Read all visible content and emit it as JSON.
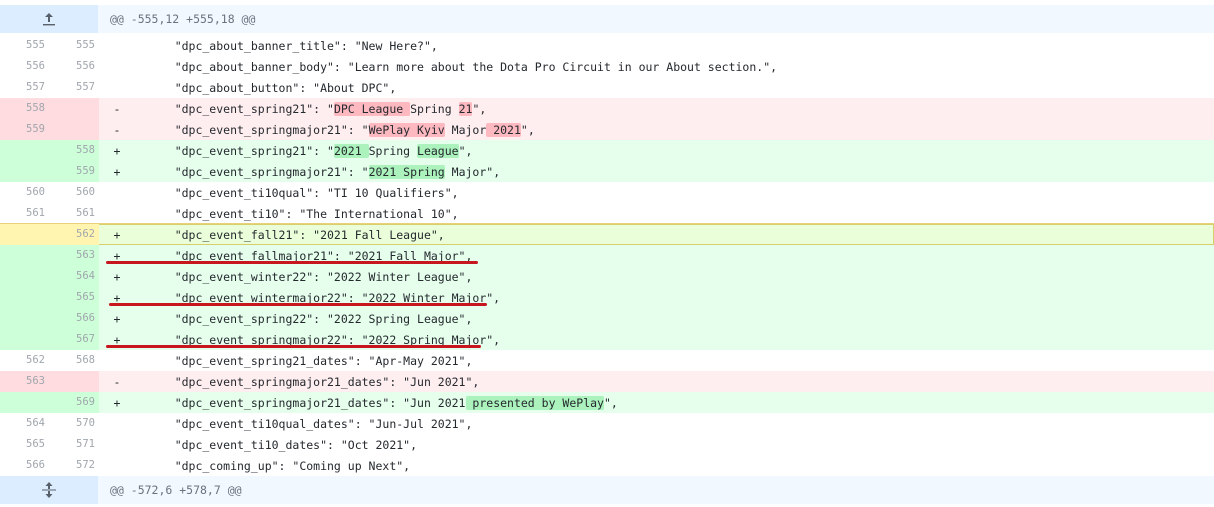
{
  "hunk_top": {
    "header": "@@ -555,12 +555,18 @@",
    "icon": "expand-up-icon"
  },
  "hunk_bottom": {
    "header": "@@ -572,6 +578,7 @@",
    "icon": "expand-both-icon"
  },
  "lines": [
    {
      "type": "ctx",
      "old": "555",
      "new": "555",
      "marker": "",
      "segments": [
        {
          "t": "    \"dpc_about_banner_title\": \"New Here?\","
        }
      ]
    },
    {
      "type": "ctx",
      "old": "556",
      "new": "556",
      "marker": "",
      "segments": [
        {
          "t": "    \"dpc_about_banner_body\": \"Learn more about the Dota Pro Circuit in our About section.\","
        }
      ]
    },
    {
      "type": "ctx",
      "old": "557",
      "new": "557",
      "marker": "",
      "segments": [
        {
          "t": "    \"dpc_about_button\": \"About DPC\","
        }
      ]
    },
    {
      "type": "del",
      "old": "558",
      "new": "",
      "marker": "-",
      "segments": [
        {
          "t": "    \"dpc_event_spring21\": \""
        },
        {
          "t": "DPC League ",
          "w": 1
        },
        {
          "t": "Spring "
        },
        {
          "t": "21",
          "w": 1
        },
        {
          "t": "\","
        }
      ]
    },
    {
      "type": "del",
      "old": "559",
      "new": "",
      "marker": "-",
      "segments": [
        {
          "t": "    \"dpc_event_springmajor21\": \""
        },
        {
          "t": "WePlay Kyiv",
          "w": 1
        },
        {
          "t": " Major"
        },
        {
          "t": " 2021",
          "w": 1
        },
        {
          "t": "\","
        }
      ]
    },
    {
      "type": "add",
      "old": "",
      "new": "558",
      "marker": "+",
      "segments": [
        {
          "t": "    \"dpc_event_spring21\": \""
        },
        {
          "t": "2021 ",
          "w": 1
        },
        {
          "t": "Spring "
        },
        {
          "t": "League",
          "w": 1
        },
        {
          "t": "\","
        }
      ]
    },
    {
      "type": "add",
      "old": "",
      "new": "559",
      "marker": "+",
      "segments": [
        {
          "t": "    \"dpc_event_springmajor21\": \""
        },
        {
          "t": "2021 Spring",
          "w": 1
        },
        {
          "t": " Major\","
        }
      ]
    },
    {
      "type": "ctx",
      "old": "560",
      "new": "560",
      "marker": "",
      "segments": [
        {
          "t": "    \"dpc_event_ti10qual\": \"TI 10 Qualifiers\","
        }
      ]
    },
    {
      "type": "ctx",
      "old": "561",
      "new": "561",
      "marker": "",
      "segments": [
        {
          "t": "    \"dpc_event_ti10\": \"The International 10\","
        }
      ]
    },
    {
      "type": "hl",
      "old": "",
      "new": "562",
      "marker": "+",
      "segments": [
        {
          "t": "    \"dpc_event_fall21\": \"2021 Fall League\","
        }
      ]
    },
    {
      "type": "add",
      "old": "",
      "new": "563",
      "marker": "+",
      "segments": [
        {
          "t": "    \"dpc_event_fallmajor21\": \"2021 Fall Major\","
        }
      ]
    },
    {
      "type": "add",
      "old": "",
      "new": "564",
      "marker": "+",
      "segments": [
        {
          "t": "    \"dpc_event_winter22\": \"2022 Winter League\","
        }
      ]
    },
    {
      "type": "add",
      "old": "",
      "new": "565",
      "marker": "+",
      "segments": [
        {
          "t": "    \"dpc_event_wintermajor22\": \"2022 Winter Major\","
        }
      ]
    },
    {
      "type": "add",
      "old": "",
      "new": "566",
      "marker": "+",
      "segments": [
        {
          "t": "    \"dpc_event_spring22\": \"2022 Spring League\","
        }
      ]
    },
    {
      "type": "add",
      "old": "",
      "new": "567",
      "marker": "+",
      "segments": [
        {
          "t": "    \"dpc_event_springmajor22\": \"2022 Spring Major\","
        }
      ]
    },
    {
      "type": "ctx",
      "old": "562",
      "new": "568",
      "marker": "",
      "segments": [
        {
          "t": "    \"dpc_event_spring21_dates\": \"Apr-May 2021\","
        }
      ]
    },
    {
      "type": "del",
      "old": "563",
      "new": "",
      "marker": "-",
      "segments": [
        {
          "t": "    \"dpc_event_springmajor21_dates\": \"Jun 2021\","
        }
      ]
    },
    {
      "type": "add",
      "old": "",
      "new": "569",
      "marker": "+",
      "segments": [
        {
          "t": "    \"dpc_event_springmajor21_dates\": \"Jun 2021"
        },
        {
          "t": " presented by WePlay",
          "w": 1
        },
        {
          "t": "\","
        }
      ]
    },
    {
      "type": "ctx",
      "old": "564",
      "new": "570",
      "marker": "",
      "segments": [
        {
          "t": "    \"dpc_event_ti10qual_dates\": \"Jun-Jul 2021\","
        }
      ]
    },
    {
      "type": "ctx",
      "old": "565",
      "new": "571",
      "marker": "",
      "segments": [
        {
          "t": "    \"dpc_event_ti10_dates\": \"Oct 2021\","
        }
      ]
    },
    {
      "type": "ctx",
      "old": "566",
      "new": "572",
      "marker": "",
      "segments": [
        {
          "t": "    \"dpc_coming_up\": \"Coming up Next\","
        }
      ]
    }
  ],
  "annotations": [
    {
      "under_line_new": "563",
      "color": "#c8161e"
    },
    {
      "under_line_new": "565",
      "color": "#c8161e"
    },
    {
      "under_line_new": "567",
      "color": "#c8161e"
    }
  ]
}
